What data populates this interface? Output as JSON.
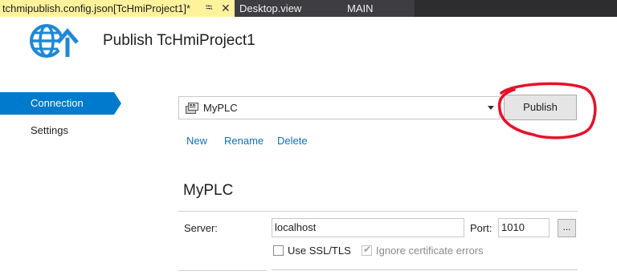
{
  "tabs": {
    "active": {
      "title": "tchmipublish.config.json[TcHmiProject1]*",
      "pin_icon": "pin-icon",
      "close_icon": "close-icon"
    },
    "others": [
      "Desktop.view",
      "MAIN"
    ]
  },
  "header": {
    "title": "Publish TcHmiProject1",
    "icon": "globe-upload-icon"
  },
  "sidebar": {
    "items": [
      {
        "label": "Connection",
        "selected": true
      },
      {
        "label": "Settings",
        "selected": false
      }
    ]
  },
  "profile": {
    "selected": "MyPLC",
    "icon": "plc-icon",
    "publish_label": "Publish",
    "links": [
      "New",
      "Rename",
      "Delete"
    ]
  },
  "connection": {
    "section_title": "MyPLC",
    "server_label": "Server:",
    "server_value": "localhost",
    "port_label": "Port:",
    "port_value": "1010",
    "browse_label": "...",
    "ssl_label": "Use SSL/TLS",
    "ssl_checked": false,
    "ignore_cert_label": "Ignore certificate errors",
    "ignore_cert_checked": true,
    "ignore_cert_enabled": false
  },
  "colors": {
    "accent": "#007acc",
    "active_tab": "#fff29d",
    "link": "#0e70c0",
    "annotation": "#e8102a"
  }
}
